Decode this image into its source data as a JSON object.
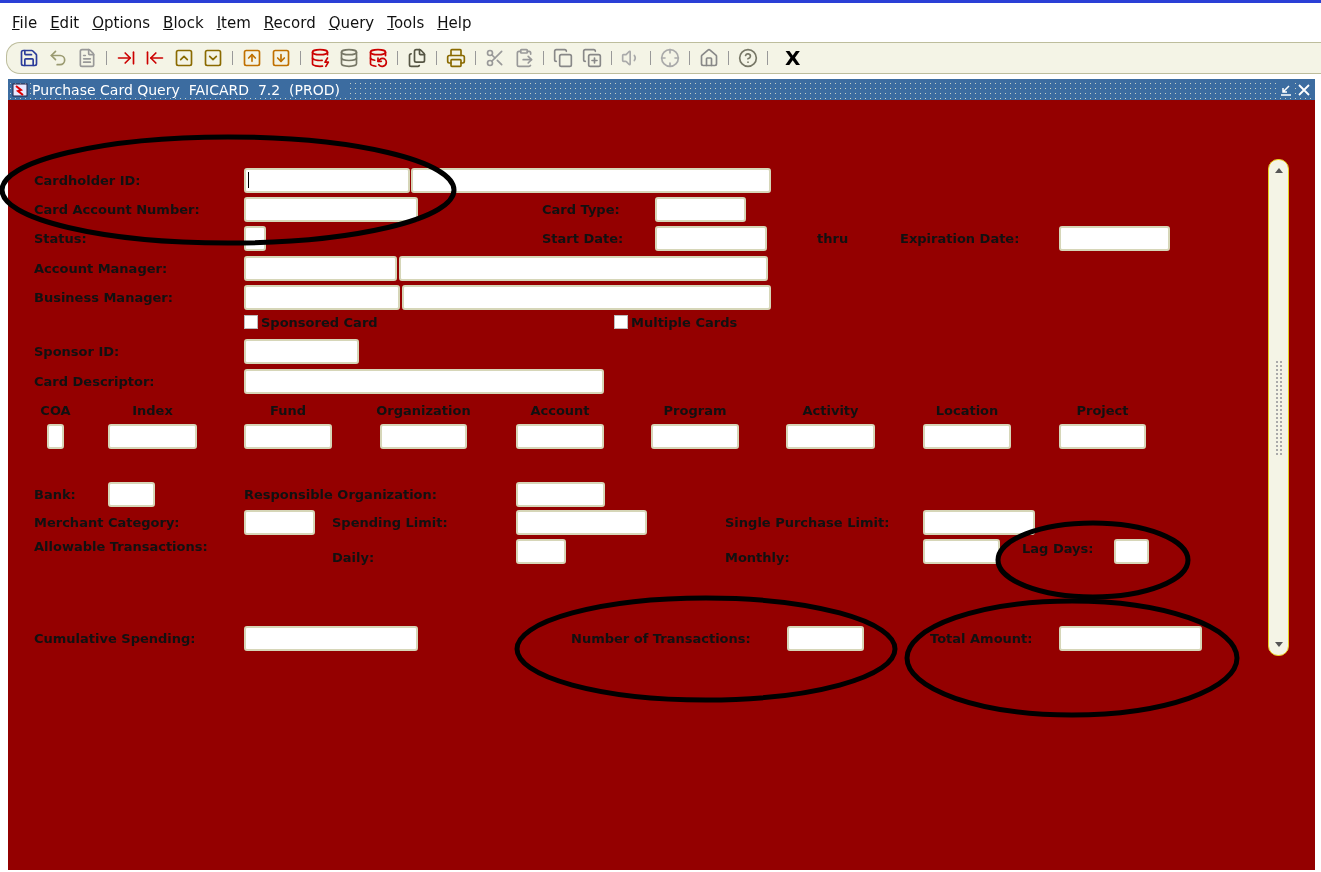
{
  "menu": [
    "File",
    "Edit",
    "Options",
    "Block",
    "Item",
    "Record",
    "Query",
    "Tools",
    "Help"
  ],
  "toolbar": {
    "exit": "X"
  },
  "window": {
    "title": "Purchase Card Query  FAICARD  7.2  (PROD)"
  },
  "form": {
    "cardholder_id": {
      "label": "Cardholder ID:",
      "focused": true
    },
    "card_account_number": {
      "label": "Card Account Number:"
    },
    "card_type": {
      "label": "Card Type:"
    },
    "status": {
      "label": "Status:"
    },
    "start_date": {
      "label": "Start Date:"
    },
    "thru": "thru",
    "expiration_date": {
      "label": "Expiration Date:"
    },
    "account_manager": {
      "label": "Account Manager:"
    },
    "business_manager": {
      "label": "Business Manager:"
    },
    "sponsored_card": {
      "label": "Sponsored Card",
      "checked": false
    },
    "multiple_cards": {
      "label": "Multiple Cards",
      "checked": false
    },
    "sponsor_id": {
      "label": "Sponsor ID:"
    },
    "card_descriptor": {
      "label": "Card Descriptor:"
    },
    "foapal_columns": [
      "COA",
      "Index",
      "Fund",
      "Organization",
      "Account",
      "Program",
      "Activity",
      "Location",
      "Project"
    ],
    "bank": {
      "label": "Bank:"
    },
    "responsible_organization": {
      "label": "Responsible Organization:"
    },
    "merchant_category": {
      "label": "Merchant Category:"
    },
    "spending_limit": {
      "label": "Spending Limit:"
    },
    "single_purchase_limit": {
      "label": "Single Purchase Limit:"
    },
    "allowable_transactions": {
      "label": "Allowable Transactions:"
    },
    "daily": {
      "label": "Daily:"
    },
    "monthly": {
      "label": "Monthly:"
    },
    "lag_days": {
      "label": "Lag Days:"
    },
    "cumulative_spending": {
      "label": "Cumulative Spending:"
    },
    "number_of_transactions": {
      "label": "Number of Transactions:"
    },
    "total_amount": {
      "label": "Total Amount:"
    }
  }
}
